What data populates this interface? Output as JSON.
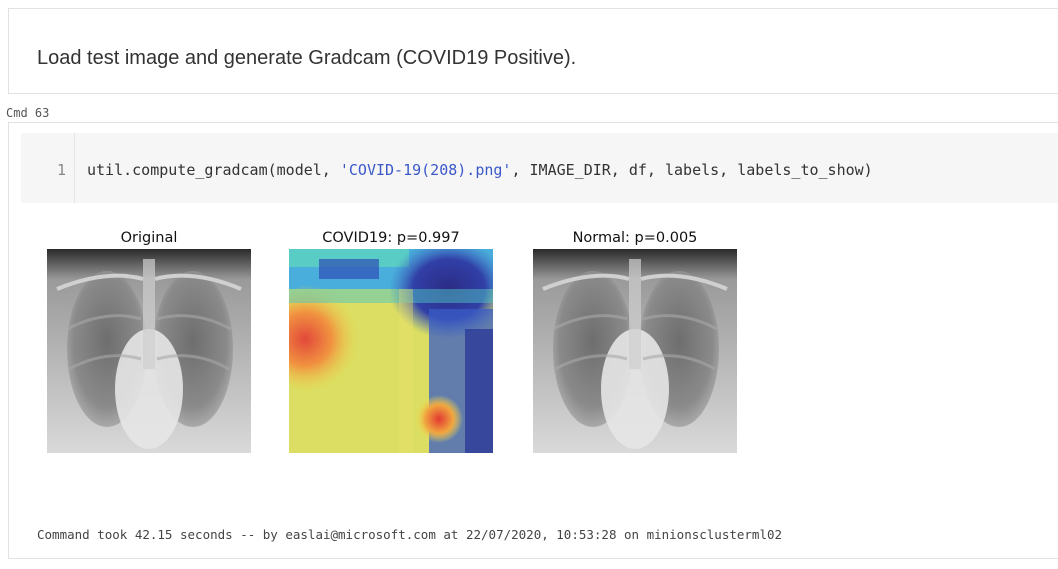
{
  "markdown": {
    "text": "Load test image and generate Gradcam (COVID19 Positive)."
  },
  "cell": {
    "label": "Cmd 63"
  },
  "code": {
    "line_number": "1",
    "prefix": "util.compute_gradcam(model, ",
    "string_arg": "'COVID-19(208).png'",
    "suffix": ", IMAGE_DIR, df, labels, labels_to_show)"
  },
  "figures": [
    {
      "title": "Original",
      "kind": "xray"
    },
    {
      "title": "COVID19: p=0.997",
      "kind": "heatmap"
    },
    {
      "title": "Normal: p=0.005",
      "kind": "xray"
    }
  ],
  "status": {
    "text": "Command took 42.15 seconds -- by easlai@microsoft.com at 22/07/2020, 10:53:28 on minionsclusterml02"
  },
  "colors": {
    "string": "#3b58c9",
    "border": "#e2e2e2",
    "editor_bg": "#f6f6f6"
  }
}
